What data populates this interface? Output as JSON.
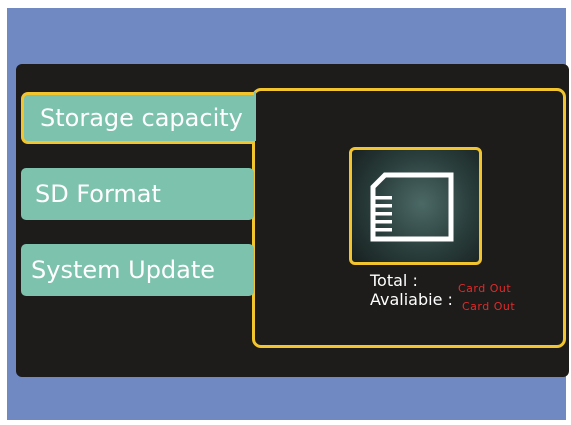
{
  "menu": {
    "items": [
      {
        "label": "Storage capacity",
        "active": true
      },
      {
        "label": "SD Format",
        "active": false
      },
      {
        "label": "System Update",
        "active": false
      }
    ]
  },
  "storage": {
    "icon": "sd-card-icon",
    "total_label": "Total :",
    "total_value": "Card Out",
    "available_label": "Avaliabie :",
    "available_value": "Card Out"
  },
  "colors": {
    "frame": "#7189c3",
    "screen": "#1d1c1a",
    "menu_item": "#7dc2ad",
    "highlight": "#f2c42d",
    "status_text": "#e02a2a"
  }
}
